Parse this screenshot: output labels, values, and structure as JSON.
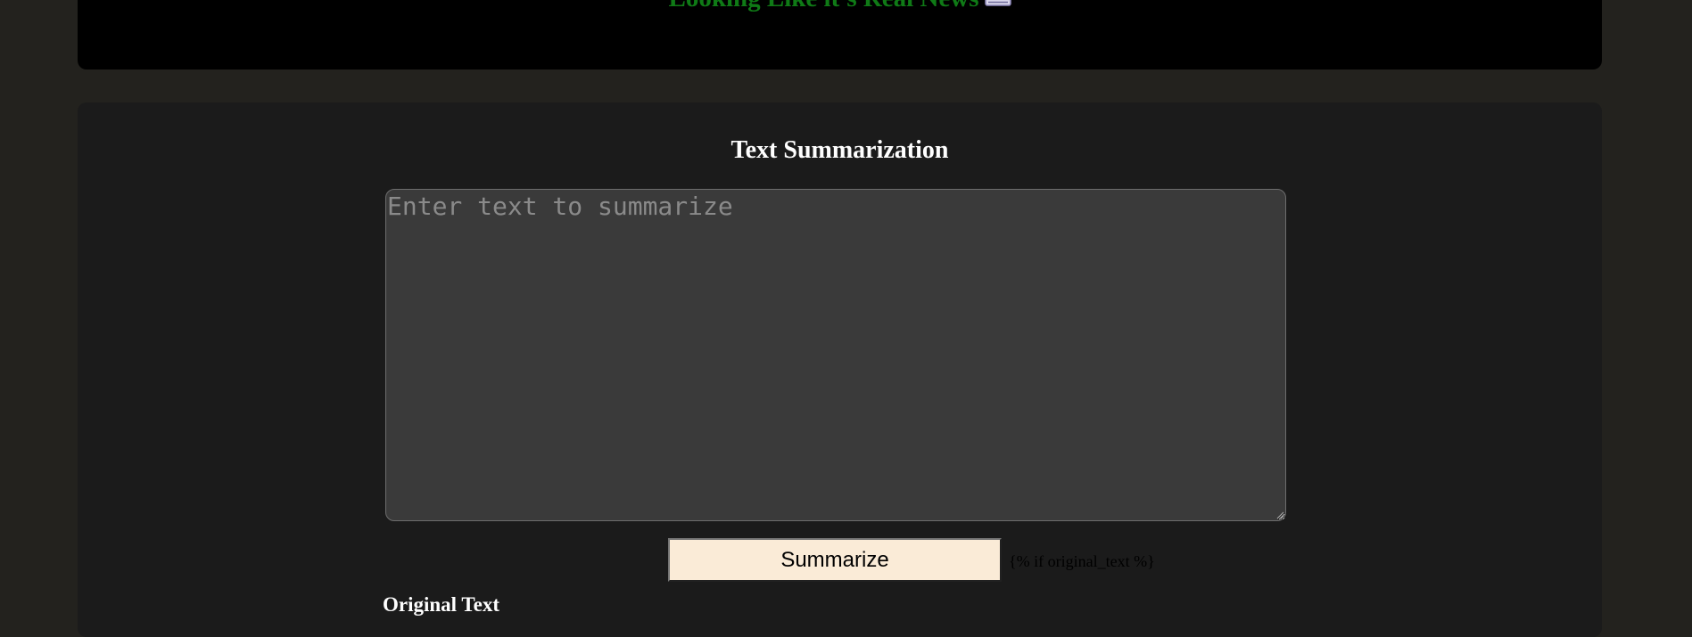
{
  "header": {
    "title": "Looking Like it's Real News",
    "icon": "newspaper-icon",
    "title_color": "#0f7a16"
  },
  "summarizer": {
    "heading": "Text Summarization",
    "input_placeholder": "Enter text to summarize",
    "input_value": "",
    "submit_label": "Summarize",
    "template_tag": "{% if original_text %}",
    "original_text_label": "Original Text"
  },
  "colors": {
    "page_background": "#23221e",
    "header_background": "#000000",
    "panel_background": "#1b1b1b",
    "input_background": "#3a3a3a",
    "button_background": "#faebd7"
  }
}
